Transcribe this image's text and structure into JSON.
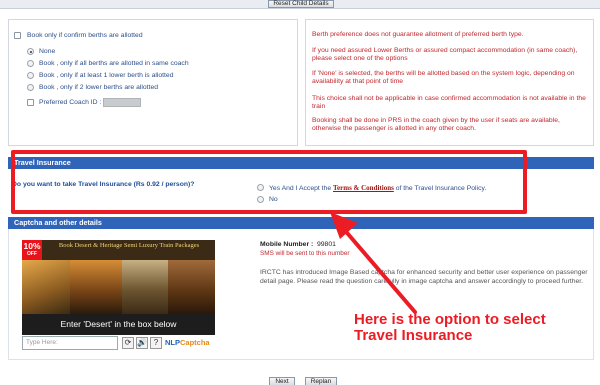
{
  "top": {
    "reset_button": "Reset Child Details"
  },
  "berth": {
    "confirm_label": "Book only if confirm berths are allotted",
    "options": [
      "None",
      "Book , only if all berths are allotted in same coach",
      "Book , only if at least 1 lower berth is allotted",
      "Book , only if 2 lower berths are allotted"
    ],
    "selected_option": "None",
    "coach_label": "Preferred Coach ID :",
    "coach_value": "",
    "notes": [
      "Berth preference does not guarantee allotment of preferred berth type.",
      "If you need assured Lower Berths or assured compact accommodation (in same coach), please select one of the options",
      "If 'None' is selected, the berths will be allotted based on the system logic, depending on availability at that point of time",
      "This choice shall not be applicable in case confirmed accommodation is not available in the train",
      "Booking shall be done in PRS in the coach given by the user if seats are available, otherwise the passenger is allotted in any other coach."
    ]
  },
  "insurance": {
    "header": "Travel Insurance",
    "question": "Do you want to take Travel Insurance (Rs 0.92 / person)?",
    "yes_prefix": "Yes And I Accept the ",
    "terms_link": "Terms & Conditions",
    "yes_suffix": " of the Travel Insurance Policy.",
    "no_label": "No"
  },
  "captcha": {
    "header": "Captcha and other details",
    "badge_percent": "10%",
    "badge_text": "OFF",
    "banner_title": "Book Desert & Heritage Semi Luxury Train Packages",
    "banner_caption": "Enter 'Desert' in the box below",
    "input_placeholder": "Type Here:",
    "controls": {
      "refresh": "⟳",
      "audio": "🔊",
      "help": "?"
    },
    "brand_a": "NLP",
    "brand_b": "Captcha",
    "mobile_label": "Mobile Number :",
    "mobile_value": "99801",
    "sms_note": "SMS will be sent to this number",
    "irctc_note": "IRCTC has introduced Image Based captcha for enhanced security and better user experience on passenger detail page. Please read the question carefully in image captcha and answer accordingly to proceed further."
  },
  "annotation": {
    "line1": "Here is the option to select",
    "line2": "Travel Insurance",
    "color": "#ec1c24"
  },
  "footer": {
    "next": "Next",
    "replan": "Replan"
  },
  "colors": {
    "section_header": "#2f64b8",
    "note_red": "#c1272d",
    "link_blue": "#2c4e8a"
  }
}
